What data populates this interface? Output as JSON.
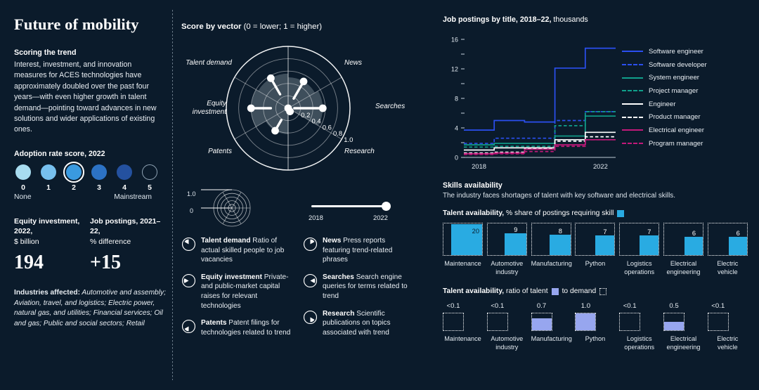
{
  "theme": {
    "bg": "#0b1b2b",
    "accent_blue": "#29abe2",
    "lavender": "#97a6ef",
    "white": "#ffffff"
  },
  "left": {
    "title": "Future of mobility",
    "scoring_heading": "Scoring the trend",
    "scoring_body": "Interest, investment, and innovation measures for ACES technologies have approximately doubled over the past four years—with even higher growth in talent demand—pointing toward advances in new solutions and wider applications of existing ones.",
    "adoption": {
      "label": "Adoption rate score, 2022",
      "selected": 2,
      "low_label": "None",
      "high_label": "Mainstream",
      "steps": [
        {
          "num": "0",
          "color": "#a8dcf0"
        },
        {
          "num": "1",
          "color": "#77c0ee"
        },
        {
          "num": "2",
          "color": "#3a9ae0"
        },
        {
          "num": "3",
          "color": "#2c72c4"
        },
        {
          "num": "4",
          "color": "#24519f"
        },
        {
          "num": "5",
          "color": "none"
        }
      ]
    },
    "stats": [
      {
        "label": "Equity investment, 2022,",
        "sub": "$ billion",
        "value": "194"
      },
      {
        "label": "Job postings, 2021–22,",
        "sub": "% difference",
        "value": "+15"
      }
    ],
    "industries_label": "Industries affected:",
    "industries_text": " Automotive and assembly; Aviation, travel, and logistics; Electric power, natural gas, and utilities; Financial services; Oil and gas; Public and social sectors; Retail"
  },
  "radar": {
    "title_bold": "Score by vector",
    "title_rest": " (0 = lower; 1 = higher)",
    "axes": [
      "News",
      "Searches",
      "Research",
      "Patents",
      "Equity investment",
      "Talent demand"
    ],
    "scale_ticks": [
      "0.2",
      "0.4",
      "0.6",
      "0.8",
      "1.0"
    ],
    "chart_data": {
      "type": "radar",
      "title": "Score by vector (0 = lower; 1 = higher)",
      "categories": [
        "News",
        "Searches",
        "Research",
        "Patents",
        "Equity investment",
        "Talent demand"
      ],
      "series": [
        {
          "name": "2018",
          "values": [
            0.18,
            0.1,
            0.04,
            0.22,
            0.28,
            0.26
          ]
        },
        {
          "name": "2022",
          "values": [
            0.5,
            0.56,
            0.06,
            0.42,
            0.6,
            0.56
          ]
        }
      ],
      "rlim": [
        0,
        1
      ],
      "grid": true
    },
    "mini_legend": {
      "high": "1.0",
      "low": "0"
    },
    "timebar": {
      "start": "2018",
      "end": "2022"
    },
    "definitions": [
      {
        "name": "Talent demand",
        "desc": " Ratio of actual skilled people to job vacancies",
        "icon": "pie-wedge-upper-left-icon",
        "angle": 240
      },
      {
        "name": "Equity investment",
        "desc": " Private- and public-market capital raises for relevant technologies",
        "icon": "pie-wedge-right-icon",
        "angle": 180
      },
      {
        "name": "Patents",
        "desc": " Patent filings for technologies related to trend",
        "icon": "pie-wedge-lower-left-icon",
        "angle": 120
      },
      {
        "name": "News",
        "desc": " Press reports featuring trend-related phrases",
        "icon": "pie-wedge-upper-right-icon",
        "angle": 300
      },
      {
        "name": "Searches",
        "desc": " Search engine queries for terms related to trend",
        "icon": "pie-wedge-left-icon",
        "angle": 0
      },
      {
        "name": "Research",
        "desc": " Scientific publications on topics associated with trend",
        "icon": "pie-wedge-lower-right-icon",
        "angle": 60
      }
    ]
  },
  "jobs_chart": {
    "title_bold": "Job postings by title, 2018–22,",
    "title_rest": " thousands",
    "chart_data": {
      "type": "line",
      "title": "Job postings by title, 2018–22, thousands",
      "ylabel": "thousands",
      "xlabel": "",
      "x": [
        "2018",
        "2019",
        "2020",
        "2021",
        "2022"
      ],
      "ylim": [
        0,
        16
      ],
      "yticks": [
        0,
        4,
        8,
        12,
        16
      ],
      "yminor": [
        2,
        6,
        10,
        14
      ],
      "xtick_labels": [
        "2018",
        "2022"
      ],
      "grid": false,
      "step": true,
      "legend_position": "right",
      "series": [
        {
          "name": "Software engineer",
          "color": "#2b4ff0",
          "style": "solid",
          "values": [
            3.7,
            5.0,
            4.8,
            12.1,
            14.8
          ]
        },
        {
          "name": "Software developer",
          "color": "#2b4ff0",
          "style": "dashed",
          "values": [
            1.9,
            2.6,
            2.6,
            5.0,
            6.2
          ]
        },
        {
          "name": "System engineer",
          "color": "#10a08b",
          "style": "solid",
          "values": [
            1.7,
            1.9,
            1.9,
            2.9,
            5.6
          ]
        },
        {
          "name": "Project manager",
          "color": "#10a08b",
          "style": "dashed",
          "values": [
            1.4,
            1.5,
            1.5,
            4.3,
            6.2
          ]
        },
        {
          "name": "Engineer",
          "color": "#ffffff",
          "style": "solid",
          "values": [
            1.0,
            1.3,
            1.3,
            2.4,
            3.4
          ]
        },
        {
          "name": "Product manager",
          "color": "#ffffff",
          "style": "dashed",
          "values": [
            0.6,
            0.7,
            1.2,
            2.2,
            2.8
          ]
        },
        {
          "name": "Electrical engineer",
          "color": "#c2197a",
          "style": "solid",
          "values": [
            0.5,
            0.6,
            1.1,
            1.7,
            2.4
          ]
        },
        {
          "name": "Program manager",
          "color": "#c2197a",
          "style": "dashed",
          "values": [
            0.4,
            0.5,
            0.8,
            1.5,
            2.4
          ]
        }
      ]
    }
  },
  "skills": {
    "heading": "Skills availability",
    "subhead": "The industry faces shortages of talent with key software and electrical skills.",
    "availability": {
      "title_bold": "Talent availability,",
      "title_rest": " % share of postings requiring skill",
      "chart_data": {
        "type": "bar",
        "title": "Talent availability, % share of postings requiring skill",
        "categories": [
          "Maintenance",
          "Automotive industry",
          "Manufacturing",
          "Python",
          "Logistics operations",
          "Electrical engineering",
          "Electric vehicle"
        ],
        "values": [
          20,
          9,
          8,
          7,
          7,
          6,
          6
        ],
        "unit": "%",
        "ylim": [
          0,
          20
        ]
      }
    },
    "ratio": {
      "title_bold": "Talent availability,",
      "title_mid": " ratio of talent ",
      "title_mid2": " to demand ",
      "chart_data": {
        "type": "bar",
        "title": "Talent availability, ratio of talent to demand",
        "categories": [
          "Maintenance",
          "Automotive industry",
          "Manufacturing",
          "Python",
          "Logistics operations",
          "Electrical engineering",
          "Electric vehicle"
        ],
        "labels": [
          "<0.1",
          "<0.1",
          "0.7",
          "1.0",
          "<0.1",
          "0.5",
          "<0.1"
        ],
        "values": [
          0.05,
          0.05,
          0.7,
          1.0,
          0.05,
          0.5,
          0.05
        ],
        "ylim": [
          0,
          1
        ]
      }
    }
  }
}
